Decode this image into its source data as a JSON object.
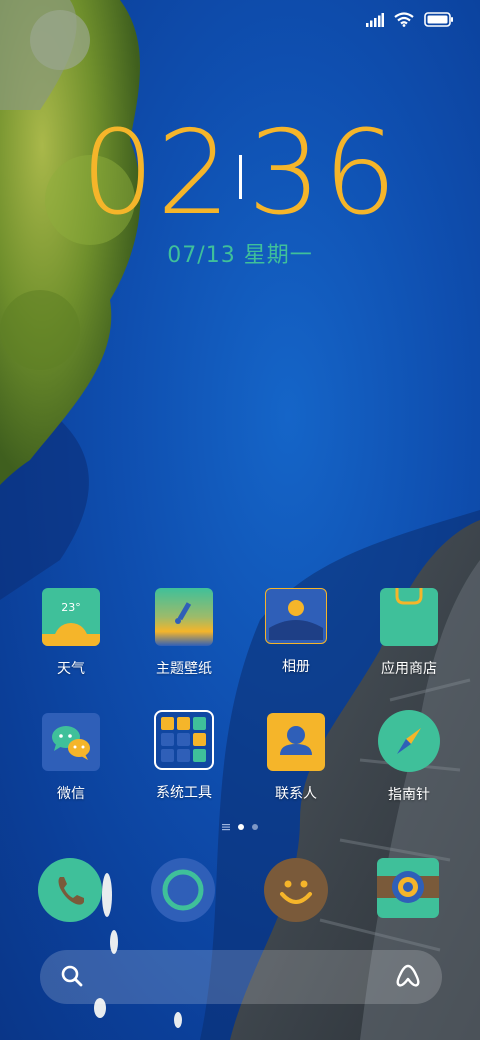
{
  "status": {
    "signal_icon": "signal-icon",
    "wifi_icon": "wifi-icon",
    "battery_icon": "battery-icon"
  },
  "clock": {
    "hours": "02",
    "minutes": "36",
    "date": "07/13 星期一"
  },
  "apps_row1": [
    {
      "label": "天气",
      "icon": "weather-icon",
      "temp": "23°"
    },
    {
      "label": "主题壁纸",
      "icon": "theme-wallpaper-icon"
    },
    {
      "label": "相册",
      "icon": "gallery-icon"
    },
    {
      "label": "应用商店",
      "icon": "app-store-icon"
    }
  ],
  "apps_row2": [
    {
      "label": "微信",
      "icon": "wechat-icon"
    },
    {
      "label": "系统工具",
      "icon": "system-tools-folder-icon"
    },
    {
      "label": "联系人",
      "icon": "contacts-icon"
    },
    {
      "label": "指南针",
      "icon": "compass-icon"
    }
  ],
  "dock": [
    {
      "icon": "phone-icon"
    },
    {
      "icon": "messages-icon"
    },
    {
      "icon": "smiley-icon"
    },
    {
      "icon": "camera-icon"
    }
  ],
  "search": {
    "search_icon": "search-icon",
    "assistant_icon": "assistant-icon"
  },
  "colors": {
    "accent_orange": "#f5b52a",
    "accent_green": "#3fc09a",
    "accent_blue": "#2f5fb8"
  }
}
